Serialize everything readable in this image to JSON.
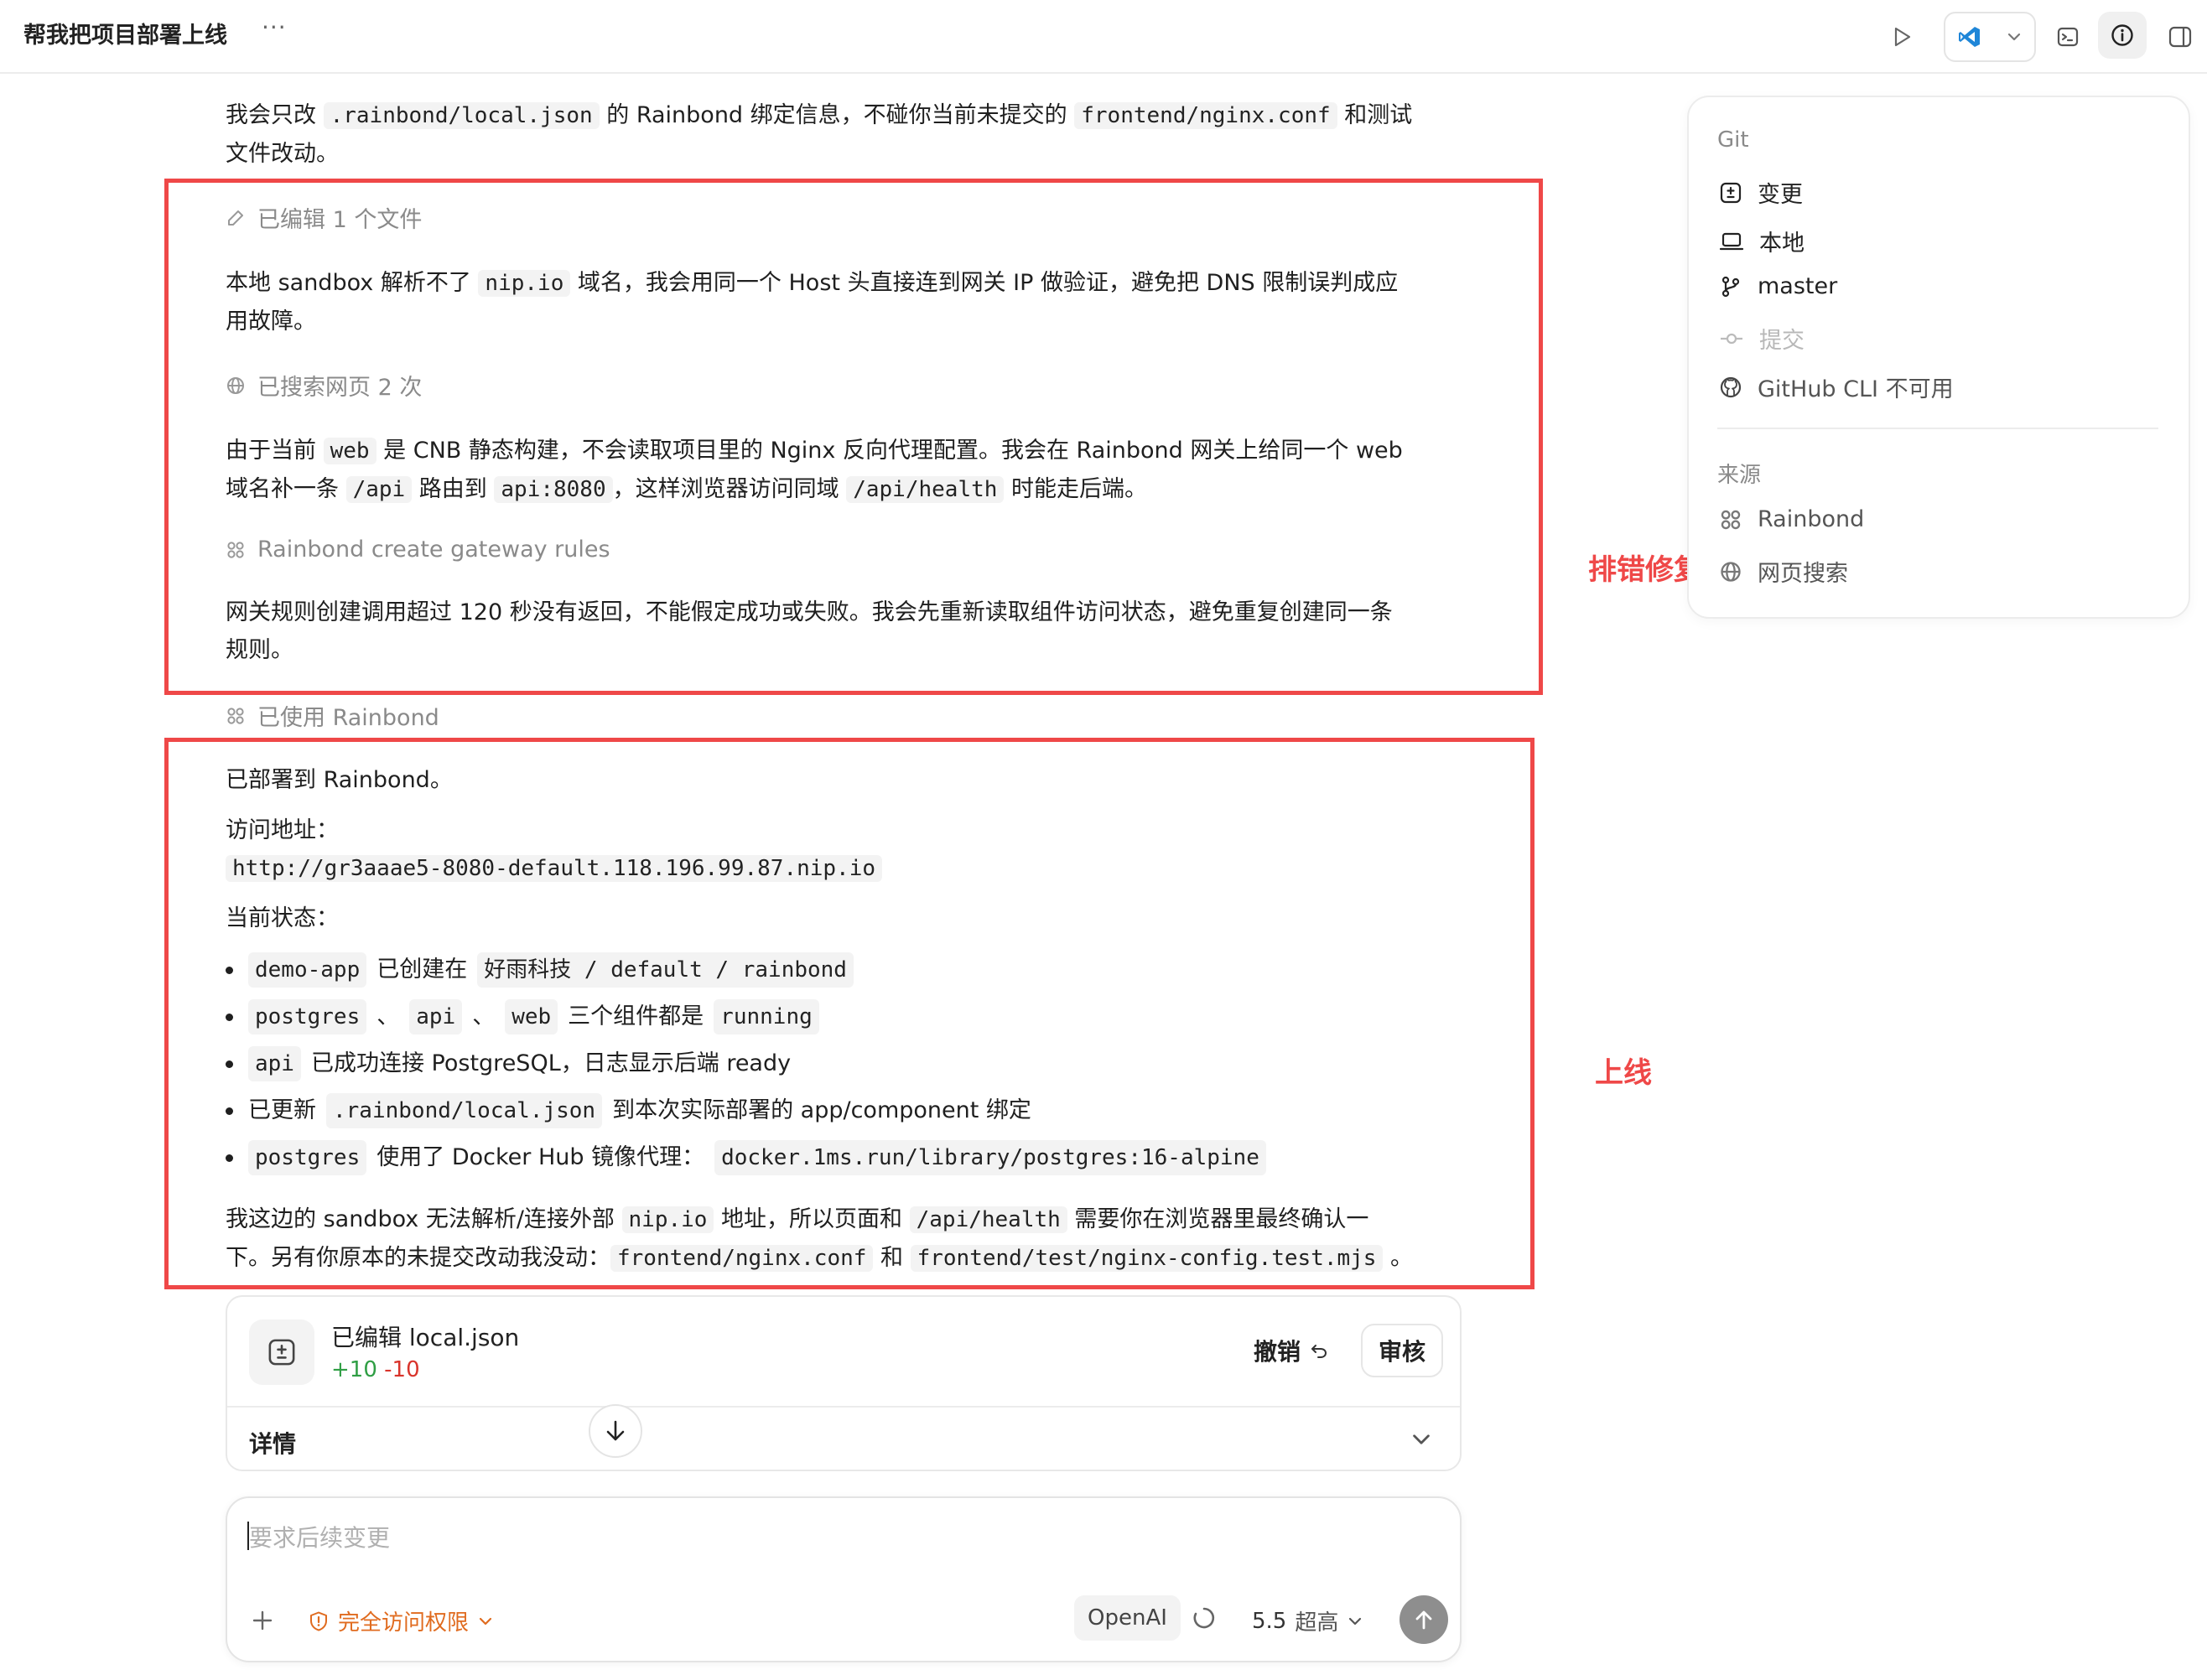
{
  "header": {
    "title": "帮我把项目部署上线",
    "more_label": "···"
  },
  "messages": {
    "intro": {
      "t1": "我会只改 ",
      "code1": ".rainbond/local.json",
      "t2": " 的 Rainbond 绑定信息，不碰你当前未提交的 ",
      "code2": "frontend/nginx.conf",
      "t3": " 和测试",
      "t4": "文件改动。"
    },
    "step_edited": "已编辑 1 个文件",
    "para1": {
      "t1": "本地 sandbox 解析不了 ",
      "code1": "nip.io",
      "t2": " 域名，我会用同一个 Host 头直接连到网关 IP 做验证，避免把 DNS 限制误判成应",
      "t3": "用故障。"
    },
    "step_search": "已搜索网页 2 次",
    "para2": {
      "t1": "由于当前 ",
      "code1": "web",
      "t2": " 是 CNB 静态构建，不会读取项目里的 Nginx 反向代理配置。我会在 Rainbond 网关上给同一个 web",
      "t3": "域名补一条 ",
      "code2": "/api",
      "t4": " 路由到 ",
      "code3": "api:8080",
      "t5": "，这样浏览器访问同域 ",
      "code4": "/api/health",
      "t6": " 时能走后端。"
    },
    "step_gateway": "Rainbond create gateway rules",
    "para3": {
      "t1": "网关规则创建调用超过 120 秒没有返回，不能假定成功或失败。我会先重新读取组件访问状态，避免重复创建同一条",
      "t2": "规则。"
    },
    "step_used": "已使用 Rainbond",
    "deployed": "已部署到 Rainbond。",
    "url_label": "访问地址：",
    "url": "http://gr3aaae5-8080-default.118.196.99.87.nip.io",
    "status_label": "当前状态：",
    "bullets": {
      "b1": {
        "code1": "demo-app",
        "t1": " 已创建在 ",
        "code2": "好雨科技 / default / rainbond"
      },
      "b2": {
        "code1": "postgres",
        "t1": " 、",
        "code2": "api",
        "t2": " 、",
        "code3": "web",
        "t3": " 三个组件都是 ",
        "code4": "running"
      },
      "b3": {
        "code1": "api",
        "t1": " 已成功连接 PostgreSQL，日志显示后端 ready"
      },
      "b4": {
        "t0": "已更新 ",
        "code1": ".rainbond/local.json",
        "t1": " 到本次实际部署的 app/component 绑定"
      },
      "b5": {
        "code1": "postgres",
        "t1": " 使用了 Docker Hub 镜像代理：",
        "code2": "docker.1ms.run/library/postgres:16-alpine"
      }
    },
    "final": {
      "t1": "我这边的 sandbox 无法解析/连接外部 ",
      "code1": "nip.io",
      "t2": " 地址，所以页面和 ",
      "code2": "/api/health",
      "t3": " 需要你在浏览器里最终确认一",
      "t4": "下。另有你原本的未提交改动我没动：",
      "code3": "frontend/nginx.conf",
      "t5": " 和 ",
      "code4": "frontend/test/nginx-config.test.mjs",
      "t6": " 。"
    }
  },
  "annotations": {
    "debug": "排错修复",
    "deploy": "上线",
    "color": "#ef4848"
  },
  "panel": {
    "git_header": "Git",
    "git_items": {
      "changes": "变更",
      "local": "本地",
      "branch": "master",
      "commit": "提交",
      "github": "GitHub CLI 不可用"
    },
    "source_header": "来源",
    "source_items": {
      "rainbond": "Rainbond",
      "websearch": "网页搜索"
    }
  },
  "edit_card": {
    "title": "已编辑 local.json",
    "added": "+10",
    "removed": "-10",
    "undo_label": "撤销",
    "review_label": "审核",
    "details_label": "详情"
  },
  "composer": {
    "placeholder": "要求后续变更",
    "value": "",
    "permission_label": "完全访问权限",
    "model_label": "OpenAI",
    "effort_version": "5.5",
    "effort_label": "超高"
  },
  "colors": {
    "accent_orange": "#e06b1f",
    "diff_add": "#2f9e44",
    "diff_remove": "#d9342b"
  }
}
